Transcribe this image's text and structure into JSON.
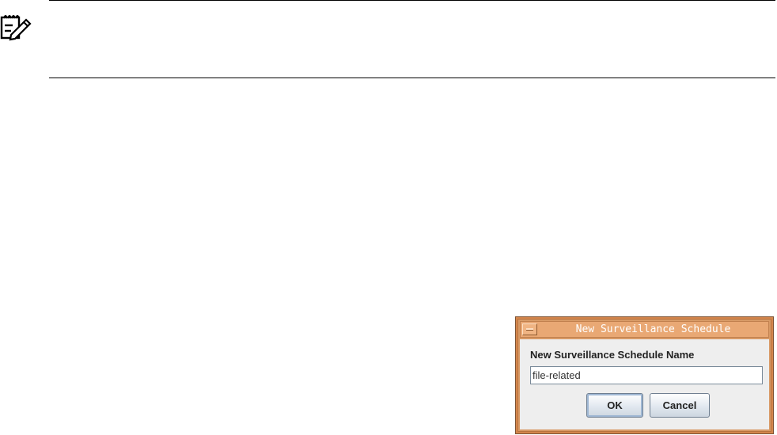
{
  "note": {
    "icon": "note-pencil-icon"
  },
  "dialog": {
    "title": "New Surveillance Schedule",
    "field_label": "New Surveillance Schedule Name",
    "input_value": "file-related",
    "ok_label": "OK",
    "cancel_label": "Cancel",
    "colors": {
      "frame": "#d4864c",
      "titlebar": "#e9a874",
      "body": "#eeeeee"
    }
  }
}
